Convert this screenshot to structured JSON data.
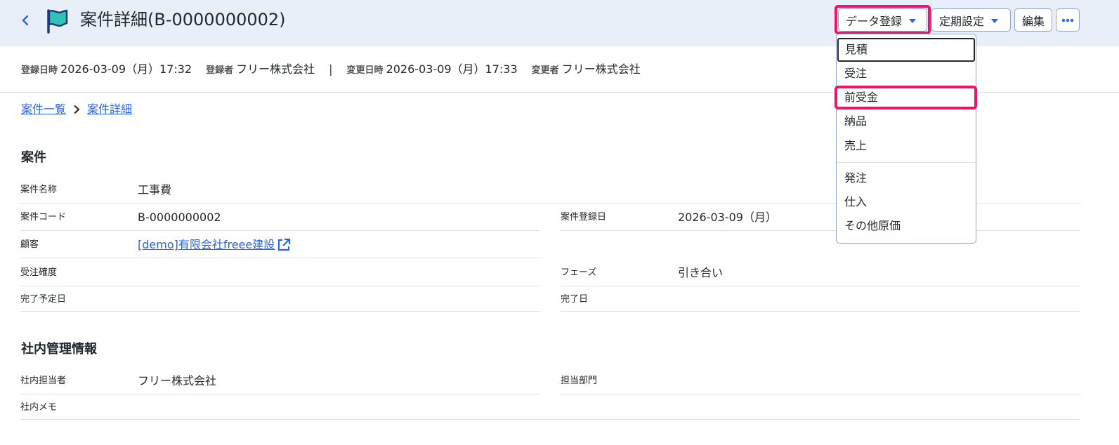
{
  "header": {
    "title": "案件詳細(B-0000000002)",
    "buttons": {
      "data_register": "データ登録",
      "periodic": "定期設定",
      "edit": "編集",
      "more": "···"
    }
  },
  "meta": {
    "created_at_label": "登録日時",
    "created_at": "2026-03-09（月）17:32",
    "created_by_label": "登録者",
    "created_by": "フリー株式会社",
    "separator": "|",
    "updated_at_label": "変更日時",
    "updated_at": "2026-03-09（月）17:33",
    "updated_by_label": "変更者",
    "updated_by": "フリー株式会社"
  },
  "breadcrumb": {
    "items": [
      "案件一覧",
      "案件詳細"
    ]
  },
  "project": {
    "title": "案件",
    "name_label": "案件名称",
    "name": "工事費",
    "code_label": "案件コード",
    "code": "B-0000000002",
    "reg_date_label": "案件登録日",
    "reg_date": "2026-03-09（月）",
    "customer_label": "顧客",
    "customer": "[demo]有限会社freee建設",
    "probability_label": "受注確度",
    "probability": "",
    "phase_label": "フェーズ",
    "phase": "引き合い",
    "due_label": "完了予定日",
    "due": "",
    "done_label": "完了日",
    "done": ""
  },
  "internal": {
    "title": "社内管理情報",
    "owner_label": "社内担当者",
    "owner": "フリー株式会社",
    "dept_label": "担当部門",
    "dept": "",
    "memo_label": "社内メモ",
    "memo": ""
  },
  "dropdown": {
    "items": [
      "見積",
      "受注",
      "前受金",
      "納品",
      "売上",
      "発注",
      "仕入",
      "その他原価"
    ]
  },
  "colors": {
    "header_bg": "#e8eff9",
    "accent": "#2864f0",
    "highlight": "#ee1469"
  }
}
